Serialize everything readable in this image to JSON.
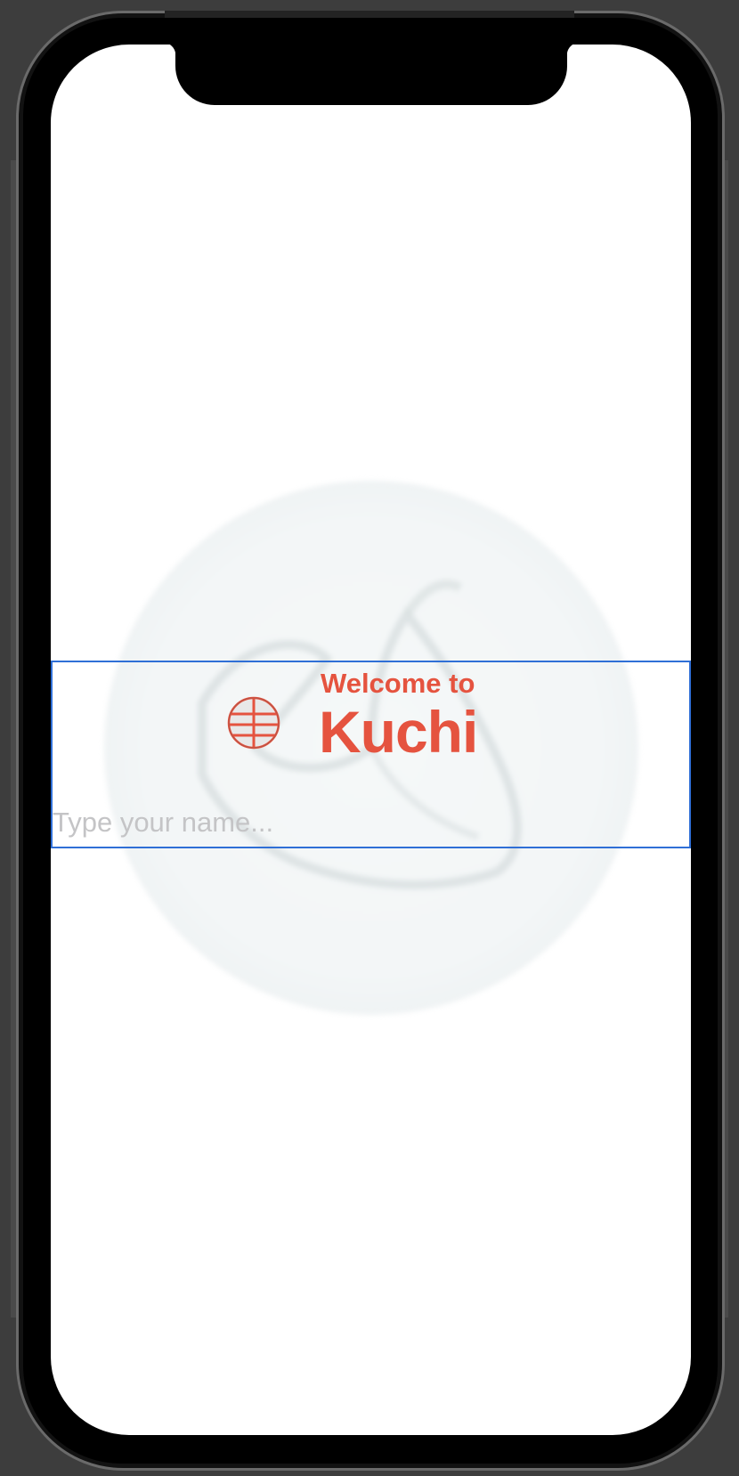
{
  "welcome": {
    "subtitle": "Welcome to",
    "title": "Kuchi"
  },
  "name_field": {
    "placeholder": "Type your name...",
    "value": ""
  },
  "colors": {
    "accent": "#e5533f",
    "focus_border": "#2f6fd6",
    "placeholder": "#c4c4c6"
  },
  "icons": {
    "logo": "kuchi-logo-icon",
    "background": "background-welcome-image"
  }
}
